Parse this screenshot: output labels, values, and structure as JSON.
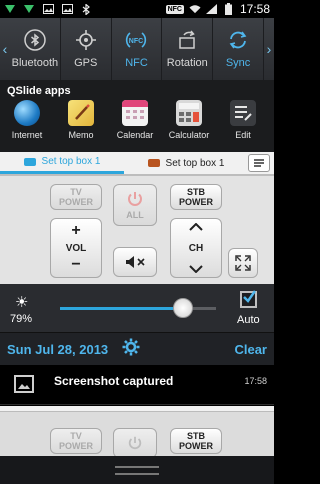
{
  "status_bar": {
    "nfc_label": "NFC",
    "time": "17:58",
    "icons": [
      "download-icon",
      "download-icon",
      "image-icon",
      "image-icon",
      "bluetooth-icon",
      "nfc-icon",
      "wifi-icon",
      "signal-icon",
      "battery-icon"
    ]
  },
  "quick_settings": {
    "items": [
      {
        "label": "Bluetooth",
        "icon": "bluetooth-icon",
        "on": false
      },
      {
        "label": "GPS",
        "icon": "gps-icon",
        "on": false
      },
      {
        "label": "NFC",
        "icon": "nfc-icon",
        "on": true
      },
      {
        "label": "Rotation",
        "icon": "rotation-icon",
        "on": false
      },
      {
        "label": "Sync",
        "icon": "sync-icon",
        "on": true
      }
    ],
    "accent": "#4fb6ec"
  },
  "qslide": {
    "title": "QSlide apps",
    "apps": [
      {
        "label": "Internet",
        "icon": "globe-icon"
      },
      {
        "label": "Memo",
        "icon": "memo-icon"
      },
      {
        "label": "Calendar",
        "icon": "calendar-icon"
      },
      {
        "label": "Calculator",
        "icon": "calculator-icon"
      },
      {
        "label": "Edit",
        "icon": "edit-icon"
      }
    ]
  },
  "remote": {
    "tabs": [
      {
        "label": "Set top box 1",
        "active": true
      },
      {
        "label": "Set top box 1",
        "active": false
      }
    ],
    "tv_power_line1": "TV",
    "tv_power_line2": "POWER",
    "all_label": "ALL",
    "stb_power_line1": "STB",
    "stb_power_line2": "POWER",
    "vol_label": "VOL",
    "vol_plus": "+",
    "vol_minus": "−",
    "ch_label": "CH",
    "mute_icon": "mute-icon",
    "expand_icon": "expand-icon"
  },
  "brightness": {
    "value": 79,
    "label": "79%",
    "auto_label": "Auto",
    "auto_checked": true
  },
  "date_bar": {
    "date": "Sun Jul 28, 2013",
    "clear_label": "Clear"
  },
  "notification": {
    "title": "Screenshot captured",
    "time": "17:58"
  }
}
